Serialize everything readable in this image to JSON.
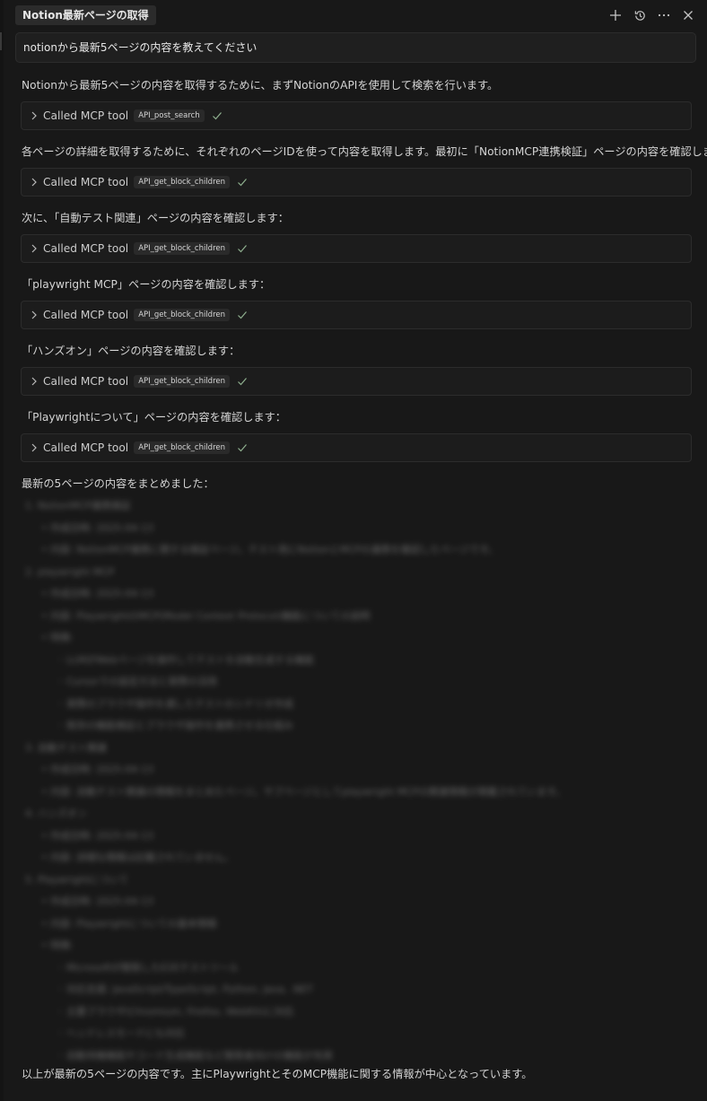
{
  "header": {
    "title": "Notion最新ページの取得",
    "icons": [
      "plus-icon",
      "history-icon",
      "more-icon",
      "close-icon"
    ]
  },
  "query": "notionから最新5ページの内容を教えてください",
  "conversation": {
    "intro": "Notionから最新5ページの内容を取得するために、まずNotionのAPIを使用して検索を行います。",
    "tool_prefix": "Called MCP tool",
    "tool1": "API_post_search",
    "step2": "各ページの詳細を取得するために、それぞれのページIDを使って内容を取得します。最初に「NotionMCP連携検証」ページの内容を確認します：",
    "tool2": "API_get_block_children",
    "step3": "次に、「自動テスト関連」ページの内容を確認します：",
    "tool3": "API_get_block_children",
    "step4": "「playwright MCP」ページの内容を確認します：",
    "tool4": "API_get_block_children",
    "step5": "「ハンズオン」ページの内容を確認します：",
    "tool5": "API_get_block_children",
    "step6": "「Playwrightについて」ページの内容を確認します：",
    "tool6": "API_get_block_children",
    "summary_heading": "最新の5ページの内容をまとめました：",
    "summary_footer": "以上が最新の5ページの内容です。主にPlaywrightとそのMCP機能に関する情報が中心となっています。"
  },
  "blurred_summary": {
    "p1": "1. NotionMCP連携検証",
    "p1a": "作成日時: 2025-04-13",
    "p1b": "内容: NotionMCP連携に関する検証ページ。テスト用にNotionとMCPの連携を確認したページです。",
    "p2": "2. playwright MCP",
    "p2a": "作成日時: 2025-04-13",
    "p2b": "内容: PlaywrightのMCP(Model Context Protocol)機能についての説明",
    "p2c": "特徴:",
    "p2d": "LLMがWebページを操作してテストを自動生成する機能",
    "p2e": "Cursorでの設定方法と実際の活用",
    "p2f": "実際のブラウザ操作を通したテストのシナリオ作成",
    "p2g": "既存の機能検証とブラウザ操作を連携させる仕組み",
    "p3": "3. 自動テスト関連",
    "p3a": "作成日時: 2025-04-13",
    "p3b": "内容: 自動テスト関連の情報をまとめたページ。サブページとしてplaywright MCPの関連情報が掲載されています。",
    "p4": "4. ハンズオン",
    "p4a": "作成日時: 2025-04-13",
    "p4b": "内容: 詳細な情報は記載されていません。",
    "p5": "5. Playwrightについて",
    "p5a": "作成日時: 2025-04-13",
    "p5b": "内容: Playwrightについての基本情報",
    "p5c": "特徴:",
    "p5d": "Microsoftが開発したE2Eテストツール",
    "p5e": "対応言語: JavaScript/TypeScript, Python, Java, .NET",
    "p5f": "主要ブラウザ(Chromium, Firefox, WebKit)に対応",
    "p5g": "ヘッドレスモードにも対応",
    "p5h": "自動待機機能やコード生成機能など開発者向けの機能が充実"
  }
}
